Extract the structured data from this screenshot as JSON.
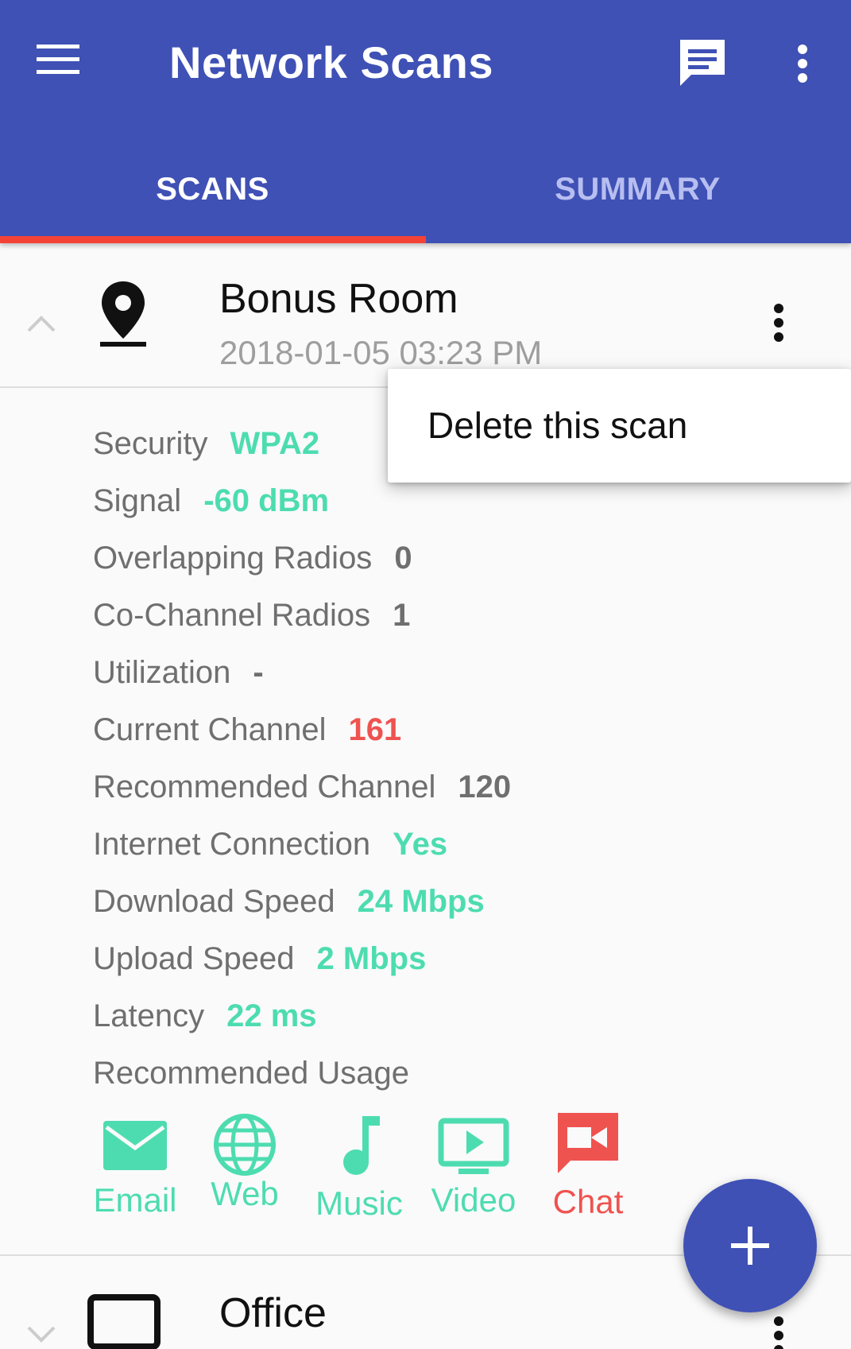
{
  "appbar": {
    "title": "Network Scans",
    "menu_icon": "hamburger-menu-icon",
    "chat_icon": "message-icon",
    "overflow_icon": "more-vert-icon",
    "color": "#3f51b5"
  },
  "tabs": [
    {
      "label": "SCANS",
      "selected": true
    },
    {
      "label": "SUMMARY",
      "selected": false
    }
  ],
  "tab_indicator_color": "#f44336",
  "scan": {
    "name": "Bonus Room",
    "date": "2018-01-05 03:23 PM",
    "expanded": true,
    "icon": "location-pin-icon",
    "details": [
      {
        "label": "Security",
        "value": "WPA2",
        "status": "good"
      },
      {
        "label": "Signal",
        "value": "-60 dBm",
        "status": "good"
      },
      {
        "label": "Overlapping Radios",
        "value": "0",
        "status": "neutral"
      },
      {
        "label": "Co-Channel Radios",
        "value": "1",
        "status": "neutral"
      },
      {
        "label": "Utilization",
        "value": "-",
        "status": "neutral"
      },
      {
        "label": "Current Channel",
        "value": "161",
        "status": "bad"
      },
      {
        "label": "Recommended Channel",
        "value": "120",
        "status": "neutral"
      },
      {
        "label": "Internet Connection",
        "value": "Yes",
        "status": "good"
      },
      {
        "label": "Download Speed",
        "value": "24 Mbps",
        "status": "good"
      },
      {
        "label": "Upload Speed",
        "value": "2 Mbps",
        "status": "good"
      },
      {
        "label": "Latency",
        "value": "22 ms",
        "status": "good"
      }
    ],
    "usage_label": "Recommended Usage",
    "usage": [
      {
        "label": "Email",
        "icon": "email-icon",
        "status": "good"
      },
      {
        "label": "Web",
        "icon": "globe-icon",
        "status": "good"
      },
      {
        "label": "Music",
        "icon": "music-note-icon",
        "status": "good"
      },
      {
        "label": "Video",
        "icon": "video-icon",
        "status": "good"
      },
      {
        "label": "Chat",
        "icon": "video-chat-icon",
        "status": "bad"
      }
    ]
  },
  "scan2": {
    "name": "Office",
    "icon": "monitor-icon",
    "expanded": false
  },
  "popup": {
    "item": "Delete this scan"
  },
  "fab": {
    "icon": "plus-icon"
  },
  "colors": {
    "good": "#4ddcb0",
    "bad": "#ef5350",
    "neutral": "#6f6f6f"
  }
}
